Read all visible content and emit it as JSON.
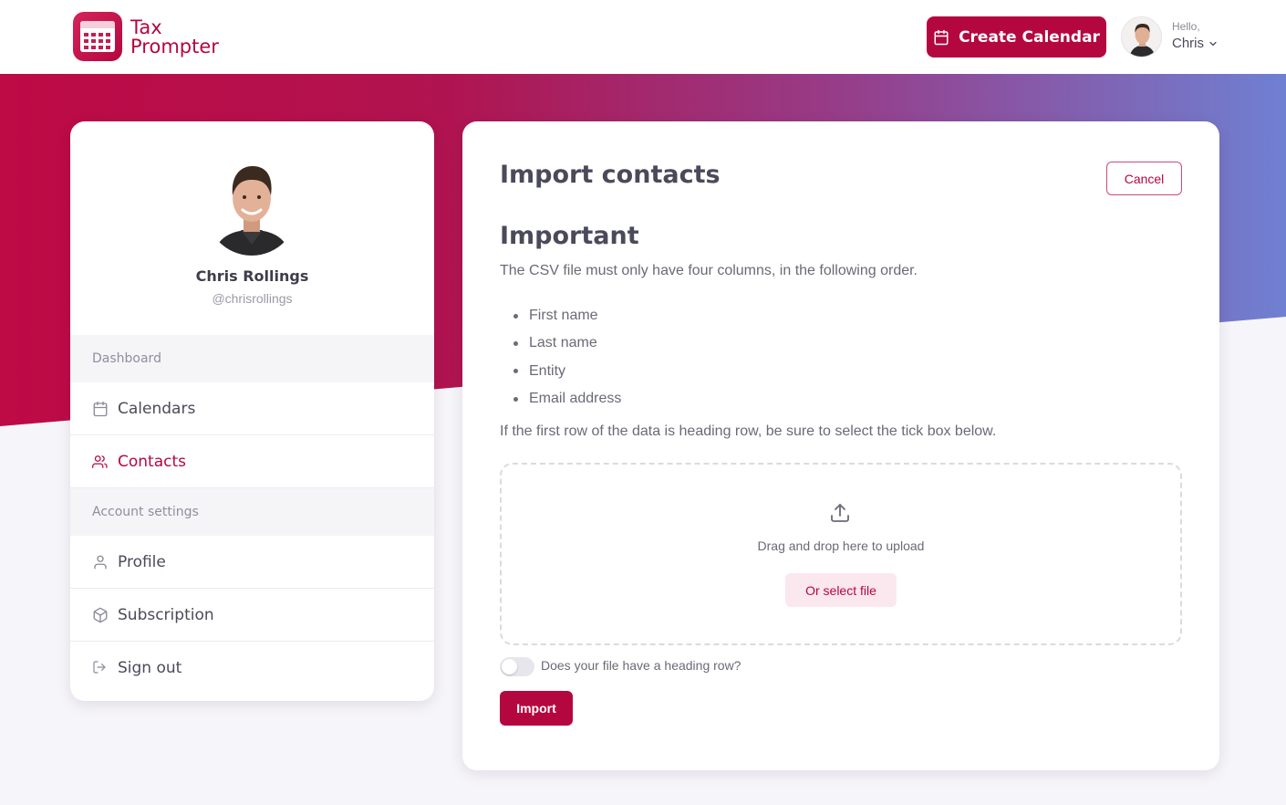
{
  "brand": {
    "name_line1": "Tax",
    "name_line2": "Prompter",
    "logo_icon": "calendar-logo-icon",
    "accent_color": "#b5073f"
  },
  "header": {
    "create_button_label": "Create Calendar",
    "greeting": "Hello,",
    "user_first_name": "Chris"
  },
  "profile": {
    "name": "Chris Rollings",
    "handle": "@chrisrollings"
  },
  "sidebar": {
    "sections": [
      {
        "label": "Dashboard",
        "items": [
          {
            "label": "Calendars",
            "icon": "calendar-icon",
            "active": false
          },
          {
            "label": "Contacts",
            "icon": "users-icon",
            "active": true
          }
        ]
      },
      {
        "label": "Account settings",
        "items": [
          {
            "label": "Profile",
            "icon": "user-icon",
            "active": false
          },
          {
            "label": "Subscription",
            "icon": "box-icon",
            "active": false
          },
          {
            "label": "Sign out",
            "icon": "sign-out-icon",
            "active": false
          }
        ]
      }
    ]
  },
  "main": {
    "title": "Import contacts",
    "cancel_label": "Cancel",
    "subtitle": "Important",
    "intro": "The CSV file must only have four columns, in the following order.",
    "columns": [
      "First name",
      "Last name",
      "Entity",
      "Email address"
    ],
    "note": "If the first row of the data is heading row, be sure to select the tick box below.",
    "dropzone": {
      "text": "Drag and drop here to upload",
      "select_label": "Or select file"
    },
    "heading_toggle_label": "Does your file have a heading row?",
    "heading_toggle_on": false,
    "import_label": "Import"
  }
}
